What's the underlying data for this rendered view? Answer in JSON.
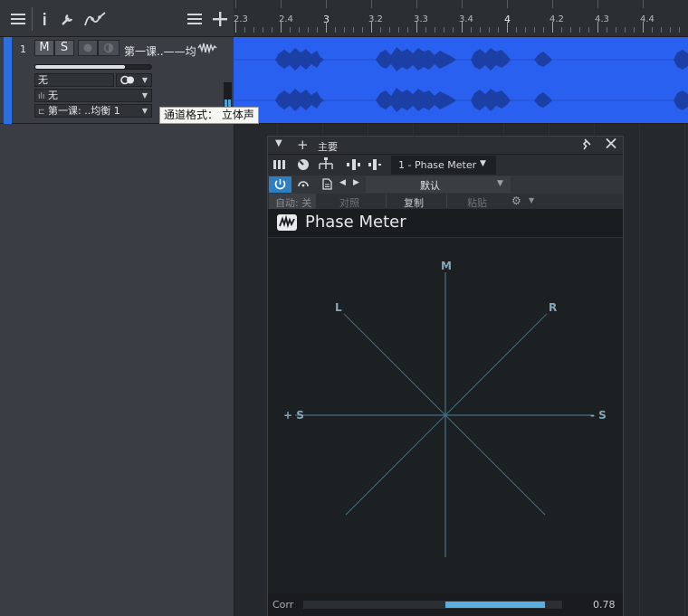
{
  "toolbar": {
    "icons": [
      "menu-icon",
      "info-icon",
      "wrench-icon",
      "automation-icon",
      "list-icon",
      "add-icon"
    ]
  },
  "ruler": {
    "labels": [
      "2.3",
      "2.4",
      "3",
      "3.2",
      "3.3",
      "3.4",
      "4",
      "4.2",
      "4.3",
      "4.4"
    ]
  },
  "track": {
    "number": "1",
    "mute_label": "M",
    "solo_label": "S",
    "name": "第一课..——均",
    "input": "无",
    "output": "无",
    "channel_name": "第一课: ..均衡 1",
    "volume_fraction": 0.77
  },
  "tooltip": "通道格式： 立体声",
  "plugin": {
    "title": "主要",
    "preset_selector": "1 - Phase Meter",
    "preset": "默认",
    "auto_label": "自动: 关",
    "compare_label": "对照",
    "copy_label": "复制",
    "paste_label": "粘贴",
    "plugin_name": "Phase Meter",
    "labels": {
      "m": "M",
      "l": "L",
      "r": "R",
      "plus_s": "+ S",
      "minus_s": "- S"
    },
    "corr_label": "Corr",
    "corr_value": "0.78",
    "corr_fraction": 0.78
  },
  "colors": {
    "clip": "#2a60f0",
    "track_color": "#2b6fe0",
    "meter_accent": "#5aaee0",
    "axis": "#4f7f97"
  }
}
